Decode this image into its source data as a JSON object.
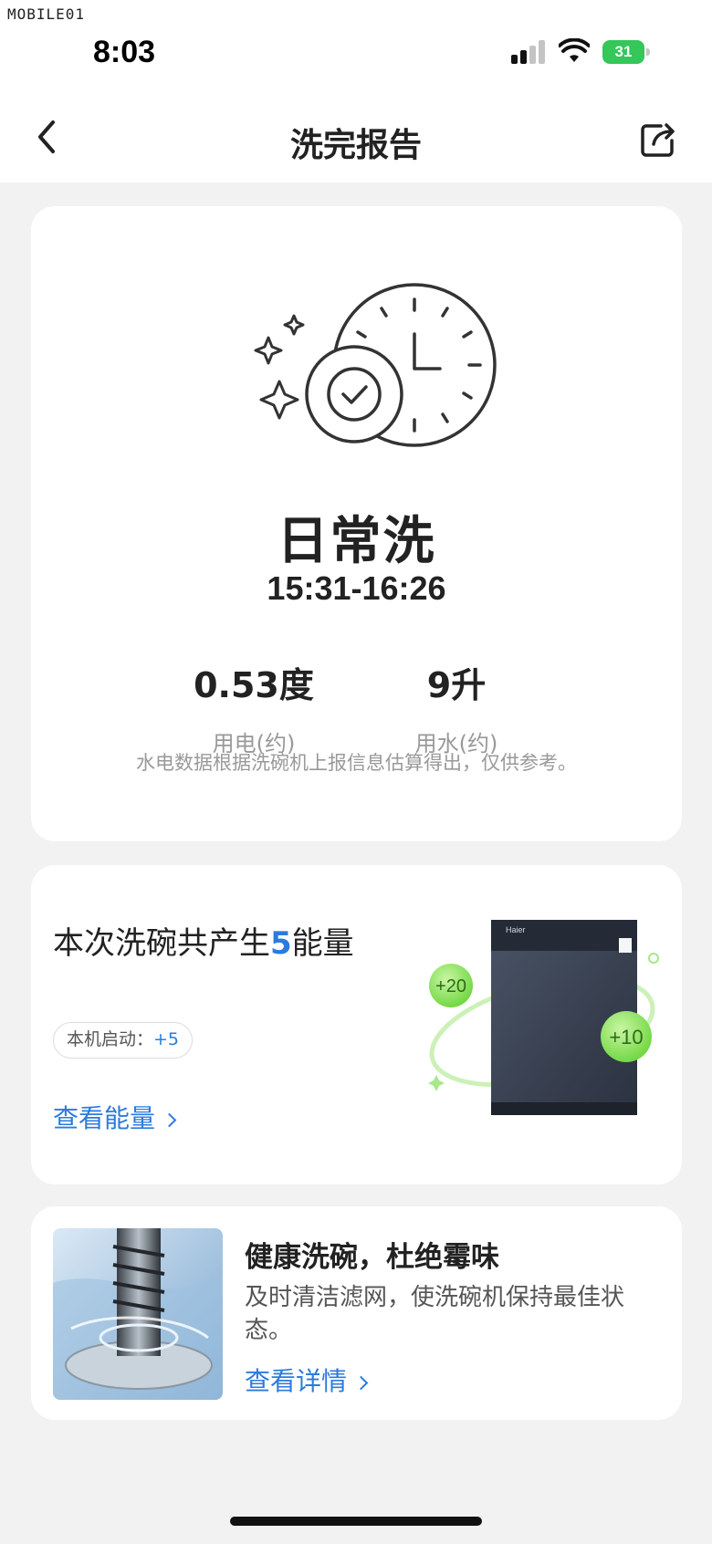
{
  "status_bar": {
    "watermark": "MOBILE01",
    "time": "8:03",
    "battery_level": "31"
  },
  "header": {
    "title": "洗完报告",
    "back_icon": "chevron-left-icon",
    "share_icon": "share-icon"
  },
  "report": {
    "mode": "日常洗",
    "time_range": "15:31-16:26",
    "power": {
      "value": "0.53度",
      "label": "用电(约)"
    },
    "water": {
      "value": "9升",
      "label": "用水(约)"
    },
    "disclaimer": "水电数据根据洗碗机上报信息估算得出，仅供参考。"
  },
  "energy": {
    "title_prefix": "本次洗碗共产生",
    "title_amount": "5",
    "title_suffix": "能量",
    "badge_label": "本机启动：",
    "badge_points": "+5",
    "link": "查看能量",
    "bubble_1": "+20",
    "bubble_2": "+10",
    "brand": "Haier"
  },
  "tip": {
    "title": "健康洗碗，杜绝霉味",
    "description": "及时清洁滤网，使洗碗机保持最佳状态。",
    "link": "查看详情"
  },
  "colors": {
    "accent_blue": "#2b7bde",
    "battery_green": "#35c759",
    "energy_green": "#7fdc4a",
    "background": "#f2f2f2"
  }
}
